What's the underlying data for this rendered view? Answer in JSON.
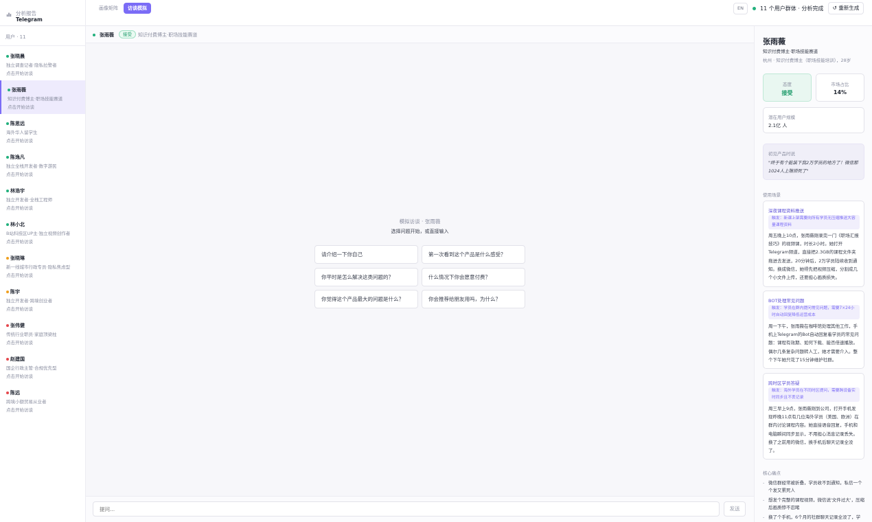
{
  "header": {
    "brand_sub": "分析报告",
    "brand_title": "Telegram",
    "tabs": [
      {
        "label": "画像矩阵",
        "active": false
      },
      {
        "label": "访谈模拟",
        "active": true
      }
    ],
    "lang_label": "EN",
    "status_text": "11  个用户群体  ·  分析完成",
    "regen_label": "↺  重新生成",
    "accent_color": "#7b6cf6"
  },
  "sidebar": {
    "users_label": "用户  ·  11",
    "items": [
      {
        "name": "张晓晨",
        "role": "独立调查记者·隐私拉警者",
        "action": "点击开始访谈",
        "dot_color": "#22b07d",
        "active": false
      },
      {
        "name": "张雨薇",
        "role": "知识付费博主·职场技能赛道",
        "action": "点击开始访谈",
        "dot_color": "#22b07d",
        "active": true
      },
      {
        "name": "陈思远",
        "role": "海外华人留学生",
        "action": "点击开始访谈",
        "dot_color": "#22b07d",
        "active": false
      },
      {
        "name": "陈逸凡",
        "role": "独立全栈开发者·数字游民",
        "action": "点击开始访谈",
        "dot_color": "#22b07d",
        "active": false
      },
      {
        "name": "林浩宇",
        "role": "独立开发者·全栈工程师",
        "action": "点击开始访谈",
        "dot_color": "#22b07d",
        "active": false
      },
      {
        "name": "林小北",
        "role": "B站科技区UP主·独立视频创作者",
        "action": "点击开始访谈",
        "dot_color": "#22b07d",
        "active": false
      },
      {
        "name": "张晓琳",
        "role": "新一线城市行政专员·隐私焦虑型",
        "action": "点击开始访谈",
        "dot_color": "#f0a020",
        "active": false
      },
      {
        "name": "陈宇",
        "role": "独立开发者·跨境创业者",
        "action": "点击开始访谈",
        "dot_color": "#f0a020",
        "active": false
      },
      {
        "name": "张伟健",
        "role": "传统行业职员·家庭顶梁柱",
        "action": "点击开始访谈",
        "dot_color": "#e5484d",
        "active": false
      },
      {
        "name": "赵建国",
        "role": "国企行政主管·合规优先型",
        "action": "点击开始访谈",
        "dot_color": "#e5484d",
        "active": false
      },
      {
        "name": "陈远",
        "role": "跨境小额贸易从业者",
        "action": "点击开始访谈",
        "dot_color": "#e5484d",
        "active": false
      }
    ]
  },
  "center": {
    "head_name": "张雨薇",
    "head_badge": "接受",
    "head_role": "知识付费博主·职场技能赛道",
    "empty_title": "模拟访谈  ·  张雨薇",
    "empty_sub": "选择问题开始，或直接输入",
    "questions": [
      "请介绍一下你自己",
      "第一次看到这个产品是什么感受？",
      "你平时是怎么解决这类问题的？",
      "什么情况下你会愿意付费？",
      "你觉得这个产品最大的问题是什么？",
      "你会推荐给朋友用吗，为什么？"
    ],
    "input_placeholder": "提问...",
    "send_label": "发送"
  },
  "profile": {
    "name": "张雨薇",
    "role": "知识付费博主·职场技能赛道",
    "meta": "杭州  ·  知识付费博主（职场技能培训），28岁",
    "attitude_label": "态度",
    "attitude_value": "接受",
    "share_label": "市场占比",
    "share_value": "14%",
    "potential_label": "潜在用户规模",
    "potential_value": "2.1亿 人",
    "quote_label": "初见产品时说",
    "quote_text": "\"终于有个能装下我2万学员的地方了！微信那1024人上限烦死了\"",
    "scenarios_label": "使用场景",
    "scenarios": [
      {
        "title": "深夜课程资料推送",
        "trigger": "触发：新课上架需要向所有学员无压缩推送大容量课程资料",
        "body": "周五晚上10点，张雨薇刚录完一门《职场汇报技巧》的视频课，时长2小时。她打开Telegram频道，直接把2.3GB的课程文件夹拖进去发送，20分钟后，2万学员陆续收到通知。换成微信，她得先把视频压缩，分割成几个小文件上传，还要担心画质损失。"
      },
      {
        "title": "BOT处理常见问题",
        "trigger": "触发：学员在群内提问常见问题，需要7×24小时自动回复降低运营成本",
        "body": "周一下午，张雨薇在咖啡馆处理其他工作，手机上Telegram的Bot自动回复着学员的常见问题：课程有效期、如何下载、能否倍速播放。偶尔几条复杂问题转人工，她才需要介入。整个下午她只花了15分钟维护社群。"
      },
      {
        "title": "跨时区学员答疑",
        "trigger": "触发：海外学员在不同时区提问，需要跨设备实时同步且不丢记录",
        "body": "周三早上9点，张雨薇刚到公司，打开手机发现昨晚11点有几位海外学员（美国、欧洲）在群内讨论课程内容。她直接语音回复，手机和电脑瞬间同步显示，不用担心消息记录丢失。换了之前用的微信，换手机后聊天记录全没了。"
      }
    ],
    "pain_label": "核心痛点",
    "pains": [
      "微信群经常被折叠，学员收不到通知，私信一个个发又累死人",
      "想发个完整的课程视频，微信说'文件过大'，压缩后画质惨不忍睹",
      "换了个手机，6个月的社群聊天记录全没了，学"
    ]
  }
}
